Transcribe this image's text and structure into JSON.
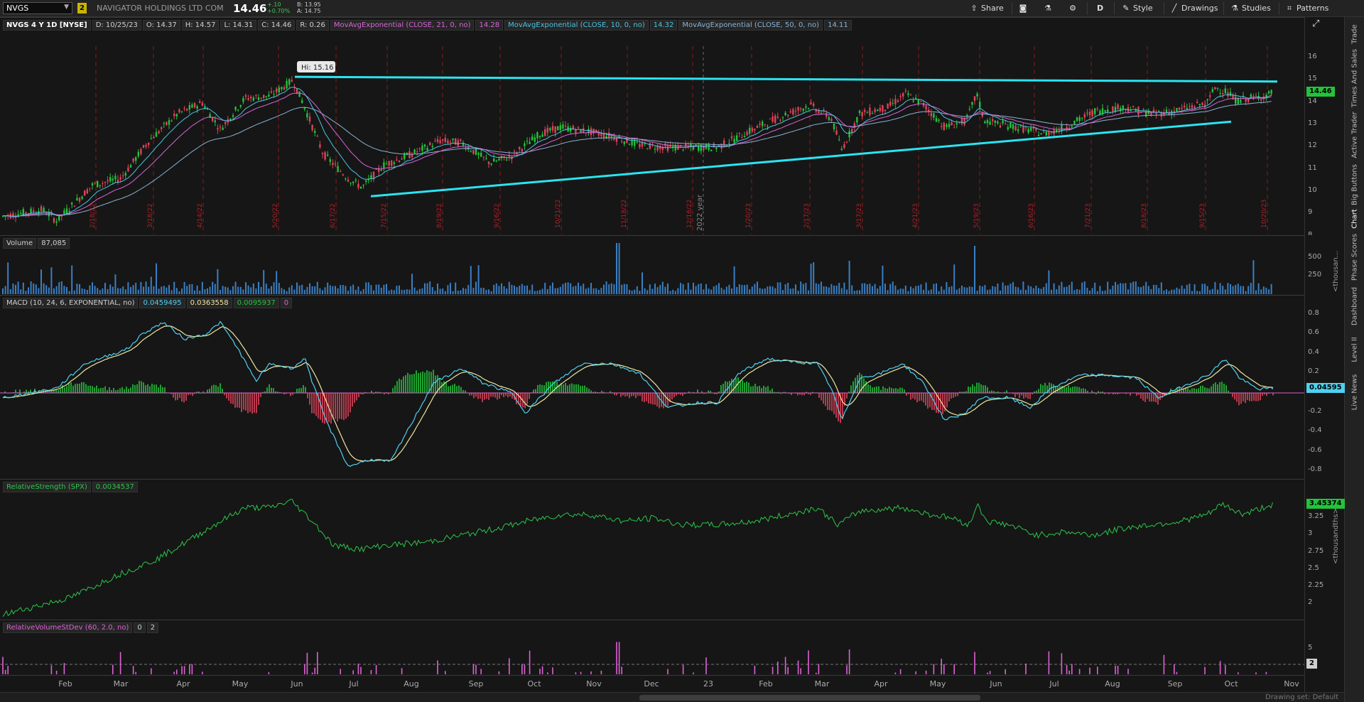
{
  "header": {
    "symbol": "NVGS",
    "link_badge": "2",
    "company": "NAVIGATOR HOLDINGS LTD COM",
    "last": "14.46",
    "change": "+.10",
    "change_pct": "+0.70%",
    "bid": "B: 13.95",
    "ask": "A: 14.75",
    "toolbar": {
      "share": "Share",
      "period": "D",
      "style": "Style",
      "drawings": "Drawings",
      "studies": "Studies",
      "patterns": "Patterns"
    }
  },
  "side_tabs": [
    "Trade",
    "Times And Sales",
    "Active Trader",
    "Big Buttons",
    "Chart",
    "Phase Scores",
    "Dashboard",
    "Level II",
    "Live News"
  ],
  "price_panel": {
    "title": "NVGS 4 Y 1D [NYSE]",
    "date": "D: 10/25/23",
    "open": "O: 14.37",
    "high": "H: 14.57",
    "low": "L: 14.31",
    "close": "C: 14.46",
    "range": "R: 0.26",
    "ema21_label": "MovAvgExponential (CLOSE, 21, 0, no)",
    "ema21_value": "14.28",
    "ema10_label": "MovAvgExponential (CLOSE, 10, 0, no)",
    "ema10_value": "14.32",
    "ema50_label": "MovAvgExponential (CLOSE, 50, 0, no)",
    "ema50_value": "14.11",
    "hi_bubble": "Hi: 15.16",
    "price_tag": "14.46",
    "year_marker": "2022 year",
    "y_ticks": [
      "16",
      "15",
      "14",
      "13",
      "12",
      "11",
      "10",
      "9",
      "8"
    ],
    "expiry_labels": [
      "2/18/22",
      "3/18/22",
      "4/14/22",
      "5/20/22",
      "6/17/22",
      "7/15/22",
      "8/19/22",
      "9/16/22",
      "10/21/22",
      "11/18/22",
      "12/16/22",
      "1/20/23",
      "2/17/23",
      "3/17/23",
      "4/21/23",
      "5/19/23",
      "6/16/23",
      "7/21/23",
      "8/18/23",
      "9/15/23",
      "10/20/23"
    ]
  },
  "volume_panel": {
    "title": "Volume",
    "value": "87,085",
    "y_ticks": [
      "500",
      "250"
    ],
    "unit": "<thousan..."
  },
  "macd_panel": {
    "title": "MACD (10, 24, 6, EXPONENTIAL, no)",
    "v1": "0.0459495",
    "v2": "0.0363558",
    "v3": "0.0095937",
    "v4": "0",
    "y_ticks": [
      "0.8",
      "0.6",
      "0.4",
      "0.2",
      "0",
      "-0.2",
      "-0.4",
      "-0.6",
      "-0.8"
    ],
    "price_tag": "0.04595"
  },
  "rs_panel": {
    "title": "RelativeStrength (SPX)",
    "value": "0.0034537",
    "y_ticks": [
      "3.25",
      "3",
      "2.75",
      "2.5",
      "2.25",
      "2"
    ],
    "price_tag": "3.45374",
    "unit": "<thousandths>"
  },
  "rv_panel": {
    "title": "RelativeVolumeStDev (60, 2.0, no)",
    "v1": "0",
    "v2": "2",
    "y_ticks": [
      "5"
    ],
    "price_tag": "2"
  },
  "x_axis": [
    "Feb",
    "Mar",
    "Apr",
    "May",
    "Jun",
    "Jul",
    "Aug",
    "Sep",
    "Oct",
    "Nov",
    "Dec",
    "23",
    "Feb",
    "Mar",
    "Apr",
    "May",
    "Jun",
    "Jul",
    "Aug",
    "Sep",
    "Oct",
    "Nov"
  ],
  "drawing_set": "Drawing set: Default",
  "colors": {
    "up": "#22c43a",
    "down": "#e0435a",
    "trendline": "#2be4f0",
    "ema21": "#d865d8",
    "ema10": "#49c4e0",
    "ema50": "#8ab2d4",
    "volume": "#3a7fc4",
    "macd": "#4fd0f0",
    "signal": "#f0e6a0",
    "rs_line": "#2cc44a",
    "rv_bars": "#e060d8"
  }
}
